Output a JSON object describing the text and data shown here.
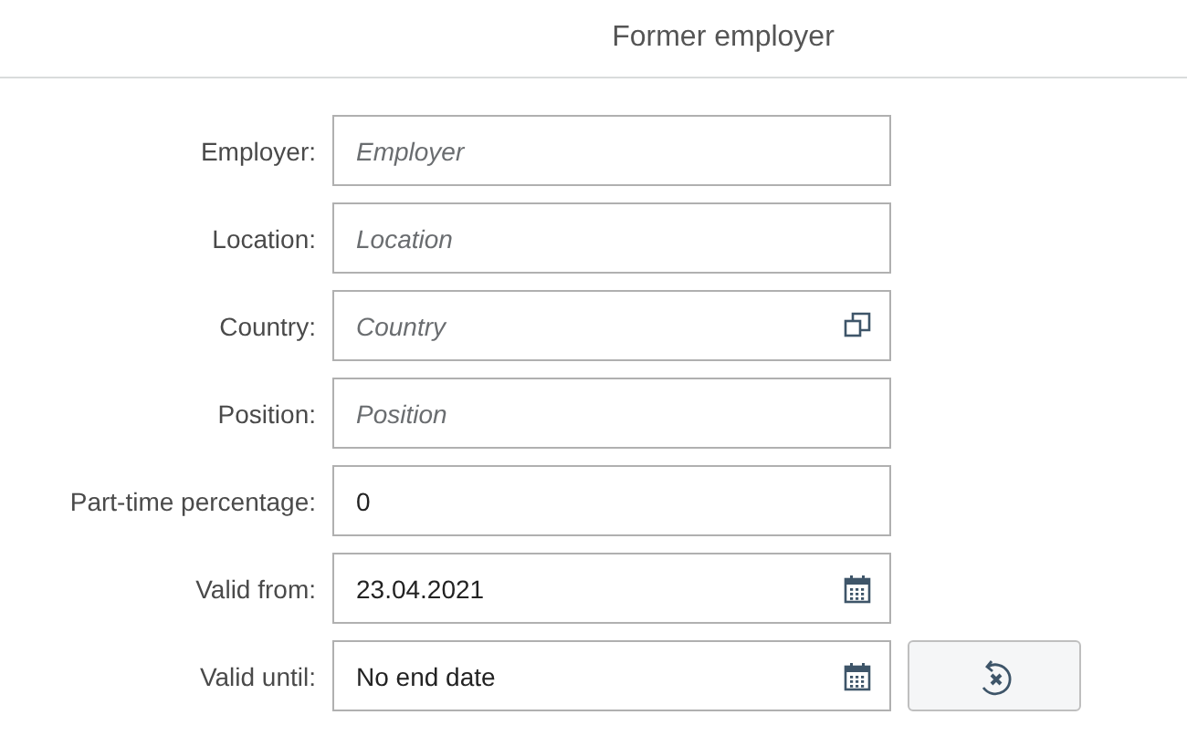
{
  "title": "Former employer",
  "fields": [
    {
      "label": "Employer:",
      "kind": "text",
      "placeholder": "Employer"
    },
    {
      "label": "Location:",
      "kind": "text",
      "placeholder": "Location"
    },
    {
      "label": "Country:",
      "kind": "valuehelp",
      "placeholder": "Country"
    },
    {
      "label": "Position:",
      "kind": "text",
      "placeholder": "Position"
    },
    {
      "label": "Part-time percentage:",
      "kind": "text",
      "value": "0"
    },
    {
      "label": "Valid from:",
      "kind": "date",
      "value": "23.04.2021"
    },
    {
      "label": "Valid until:",
      "kind": "date",
      "value": "No end date",
      "resettable": true
    }
  ]
}
